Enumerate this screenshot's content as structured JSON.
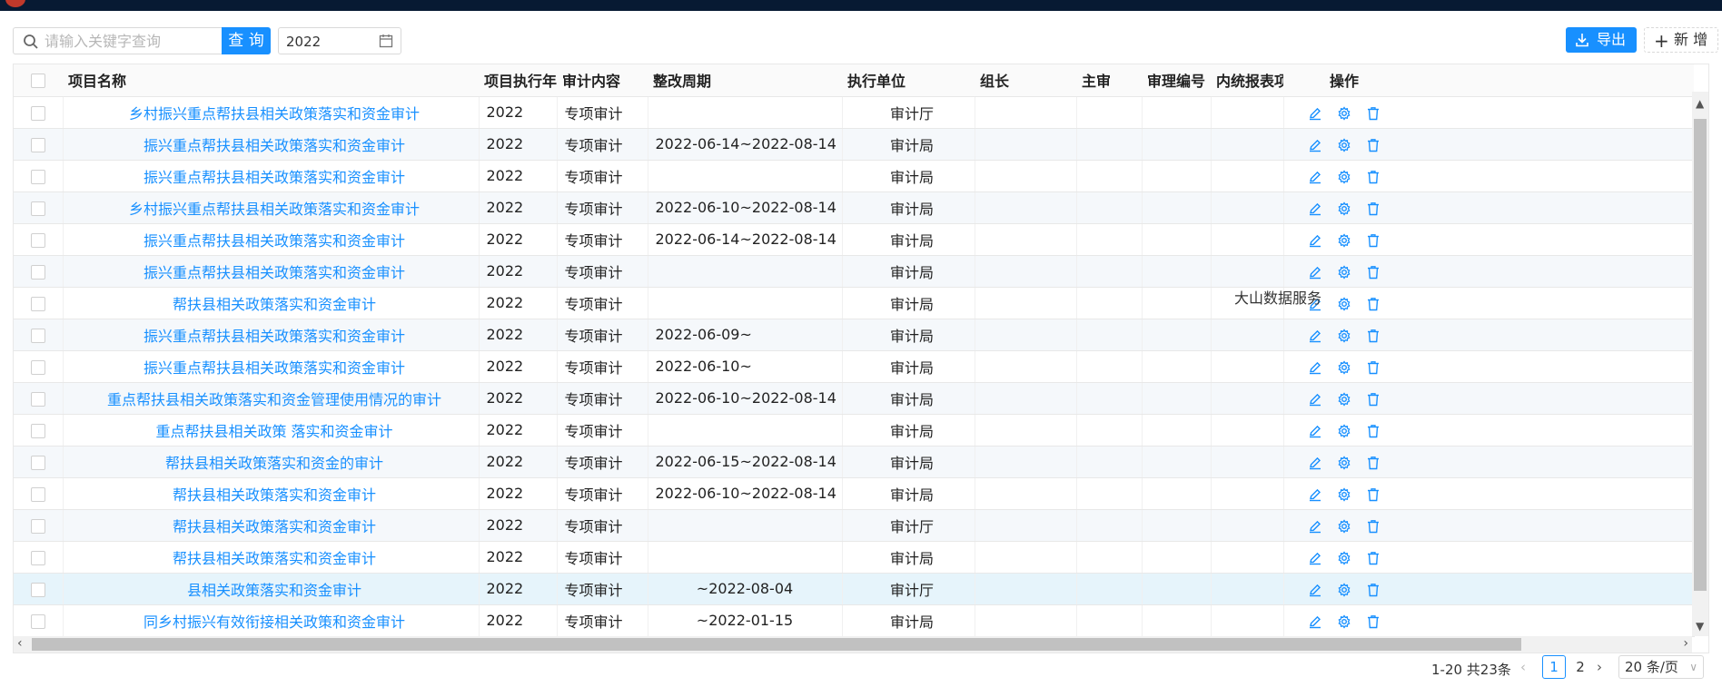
{
  "toolbar": {
    "search_placeholder": "请输入关键字查询",
    "query_label": "查 询",
    "year_value": "2022",
    "export_label": "导出",
    "add_label": "新 增"
  },
  "table": {
    "columns": [
      "项目名称",
      "项目执行年",
      "审计内容",
      "整改周期",
      "执行单位",
      "组长",
      "主审",
      "审理编号",
      "内统报表项目",
      "操作"
    ],
    "rows": [
      {
        "name": "乡村振兴重点帮扶县相关政策落实和资金审计",
        "year": "2022",
        "content": "专项审计",
        "period": "",
        "unit": "审计厅"
      },
      {
        "name": "振兴重点帮扶县相关政策落实和资金审计",
        "year": "2022",
        "content": "专项审计",
        "period": "2022-06-14~2022-08-14",
        "unit": "审计局"
      },
      {
        "name": "振兴重点帮扶县相关政策落实和资金审计",
        "year": "2022",
        "content": "专项审计",
        "period": "",
        "unit": "审计局"
      },
      {
        "name": "乡村振兴重点帮扶县相关政策落实和资金审计",
        "year": "2022",
        "content": "专项审计",
        "period": "2022-06-10~2022-08-14",
        "unit": "审计局"
      },
      {
        "name": "振兴重点帮扶县相关政策落实和资金审计",
        "year": "2022",
        "content": "专项审计",
        "period": "2022-06-14~2022-08-14",
        "unit": "审计局"
      },
      {
        "name": "振兴重点帮扶县相关政策落实和资金审计",
        "year": "2022",
        "content": "专项审计",
        "period": "",
        "unit": "审计局"
      },
      {
        "name": "帮扶县相关政策落实和资金审计",
        "year": "2022",
        "content": "专项审计",
        "period": "",
        "unit": "审计局"
      },
      {
        "name": "振兴重点帮扶县相关政策落实和资金审计",
        "year": "2022",
        "content": "专项审计",
        "period": "2022-06-09~",
        "unit": "审计局"
      },
      {
        "name": "振兴重点帮扶县相关政策落实和资金审计",
        "year": "2022",
        "content": "专项审计",
        "period": "2022-06-10~",
        "unit": "审计局"
      },
      {
        "name": "重点帮扶县相关政策落实和资金管理使用情况的审计",
        "year": "2022",
        "content": "专项审计",
        "period": "2022-06-10~2022-08-14",
        "unit": "审计局"
      },
      {
        "name": "重点帮扶县相关政策 落实和资金审计",
        "year": "2022",
        "content": "专项审计",
        "period": "",
        "unit": "审计局"
      },
      {
        "name": "帮扶县相关政策落实和资金的审计",
        "year": "2022",
        "content": "专项审计",
        "period": "2022-06-15~2022-08-14",
        "unit": "审计局"
      },
      {
        "name": "帮扶县相关政策落实和资金审计",
        "year": "2022",
        "content": "专项审计",
        "period": "2022-06-10~2022-08-14",
        "unit": "审计局"
      },
      {
        "name": "帮扶县相关政策落实和资金审计",
        "year": "2022",
        "content": "专项审计",
        "period": "",
        "unit": "审计厅"
      },
      {
        "name": "帮扶县相关政策落实和资金审计",
        "year": "2022",
        "content": "专项审计",
        "period": "",
        "unit": "审计局"
      },
      {
        "name": "县相关政策落实和资金审计",
        "year": "2022",
        "content": "专项审计",
        "period": "~2022-08-04",
        "unit": "审计厅"
      },
      {
        "name": "同乡村振兴有效衔接相关政策和资金审计",
        "year": "2022",
        "content": "专项审计",
        "period": "~2022-01-15",
        "unit": "审计局"
      }
    ],
    "overlay_text": "大山数据服务"
  },
  "pagination": {
    "total_text": "1-20 共23条",
    "page1": "1",
    "page2": "2",
    "page_size": "20 条/页"
  },
  "colors": {
    "primary": "#1890ff",
    "topbar": "#071a33"
  }
}
